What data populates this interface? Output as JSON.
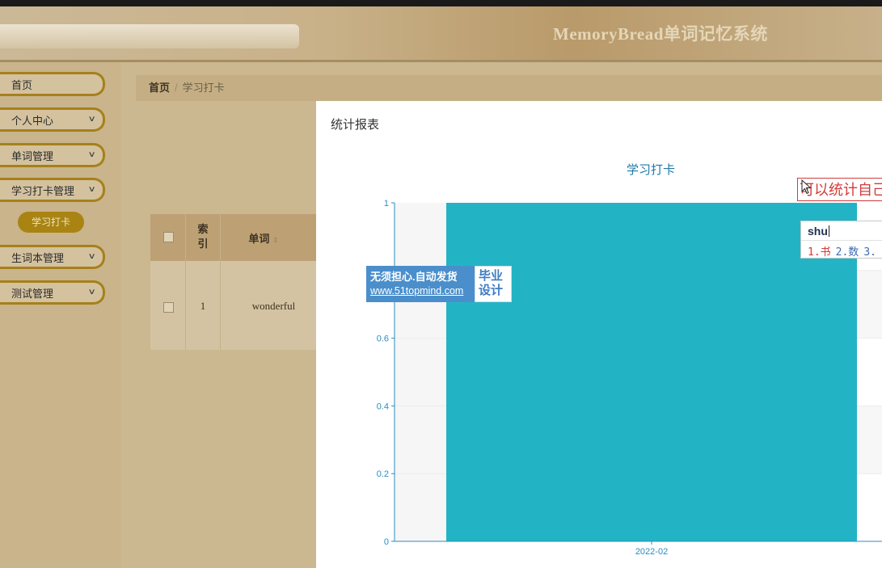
{
  "header": {
    "title": "MemoryBread单词记忆系统"
  },
  "sidebar": {
    "items": [
      {
        "label": "首页"
      },
      {
        "label": "个人中心",
        "chevron": "∨"
      },
      {
        "label": "单词管理",
        "chevron": "∨"
      },
      {
        "label": "学习打卡管理",
        "chevron": "∨"
      },
      {
        "label": "生词本管理",
        "chevron": "∨"
      },
      {
        "label": "测试管理",
        "chevron": "∨"
      }
    ],
    "sub_item": {
      "label": "学习打卡"
    }
  },
  "breadcrumb": {
    "home": "首页",
    "separator": "/",
    "current": "学习打卡"
  },
  "table": {
    "headers": {
      "index": "索引",
      "word": "单词"
    },
    "rows": [
      {
        "index": "1",
        "word": "wonderful"
      }
    ]
  },
  "modal": {
    "title": "统计报表"
  },
  "chart_data": {
    "type": "bar",
    "title": "学习打卡",
    "categories": [
      "2022-02"
    ],
    "values": [
      1
    ],
    "ylim": [
      0,
      1
    ],
    "yticks": [
      "0",
      "0.2",
      "0.4",
      "0.6",
      "1"
    ],
    "color": "#22b4c5",
    "grid": true
  },
  "watermark": {
    "line1": "无须担心.自动发货",
    "line2": "www.51topmind.com",
    "right": "毕业设计"
  },
  "ime": {
    "caption": "可以统计自己",
    "input": "shu",
    "candidates": [
      "1.书",
      "2.数",
      "3."
    ]
  },
  "colors": {
    "accent": "#a6801a",
    "bar": "#22b4c5",
    "axis": "#2a8cc0"
  }
}
